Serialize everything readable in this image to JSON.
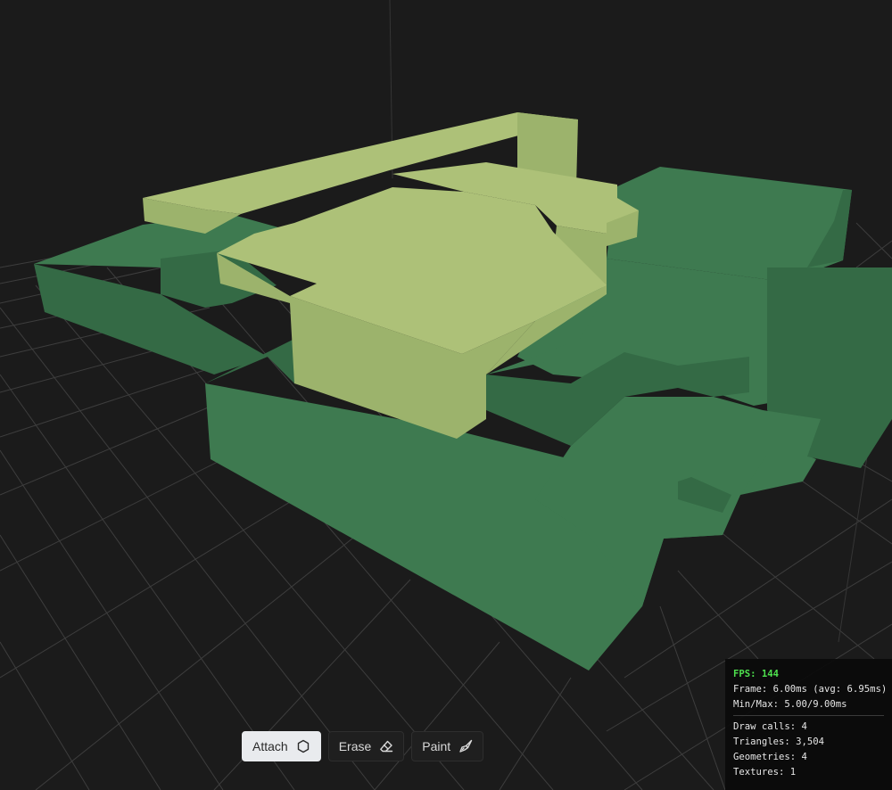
{
  "toolbar": {
    "buttons": [
      {
        "label": "Attach",
        "icon": "hexagon-icon",
        "active": true
      },
      {
        "label": "Erase",
        "icon": "eraser-icon",
        "active": false
      },
      {
        "label": "Paint",
        "icon": "paintbrush-icon",
        "active": false
      }
    ]
  },
  "stats": {
    "fps": "FPS: 144",
    "frame": "Frame: 6.00ms (avg: 6.95ms)",
    "minmax": "Min/Max: 5.00/9.00ms",
    "draw_calls": "Draw calls: 4",
    "triangles": "Triangles: 3,504",
    "geometries": "Geometries: 4",
    "textures": "Textures: 1"
  },
  "colors": {
    "background": "#1b1b1b",
    "grid_line": "#4a4a4a",
    "dark_green_top": "#3e7a50",
    "dark_green_side": "#346a45",
    "light_green_top": "#adc178",
    "light_green_side": "#9cb36c",
    "fps_green": "#4ee04e"
  }
}
